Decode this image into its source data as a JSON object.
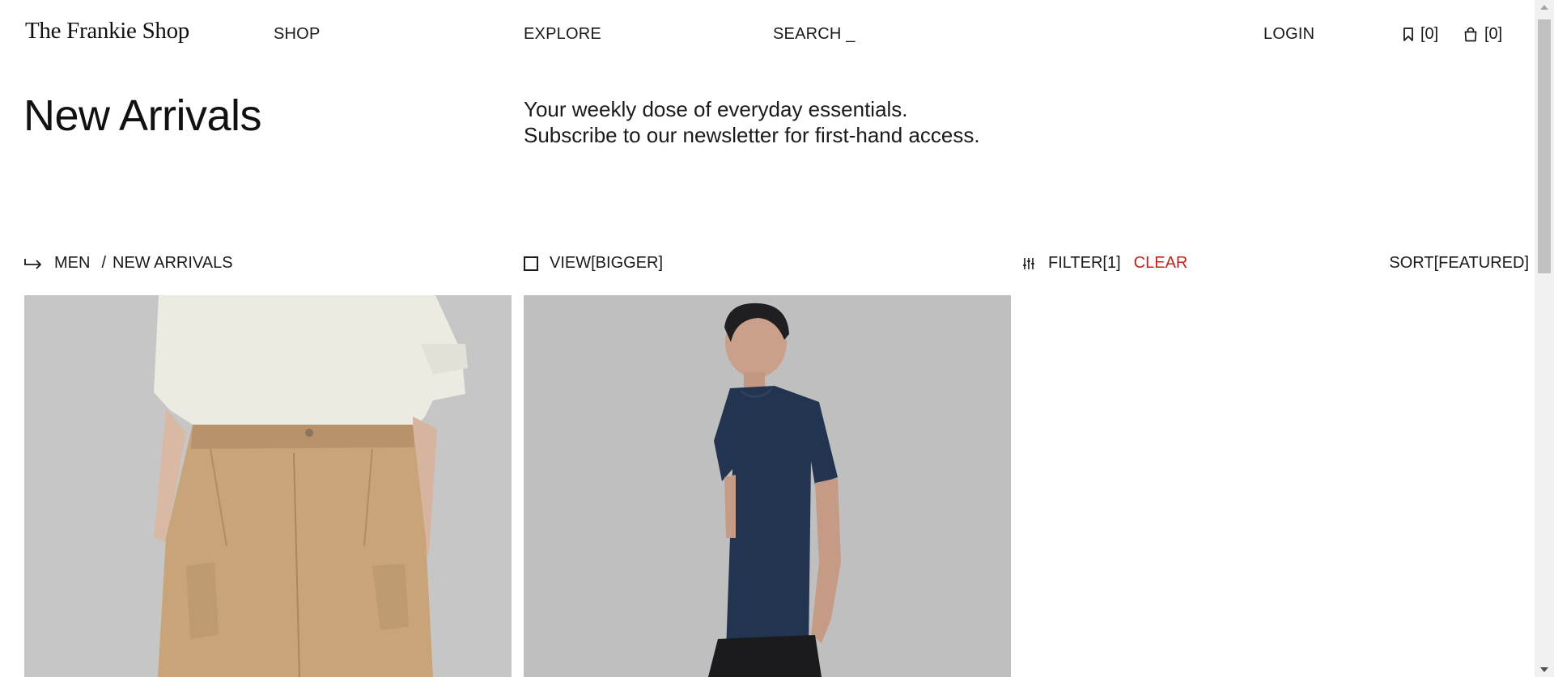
{
  "header": {
    "logo": "The Frankie Shop",
    "nav": {
      "shop": "SHOP",
      "explore": "EXPLORE",
      "search": "SEARCH _",
      "login": "LOGIN"
    },
    "wishlist": {
      "icon": "bookmark-icon",
      "count": "[0]"
    },
    "bag": {
      "icon": "shopping-bag-icon",
      "count": "[0]"
    }
  },
  "intro": {
    "title": "New Arrivals",
    "line1": "Your weekly dose of everyday essentials.",
    "line2": "Subscribe to our newsletter for first-hand access."
  },
  "toolbar": {
    "breadcrumb": {
      "icon": "arrow-right-icon",
      "parent": "MEN",
      "separator": "/",
      "current": "NEW ARRIVALS"
    },
    "view": {
      "icon": "square-icon",
      "label": "VIEW[BIGGER]"
    },
    "filter": {
      "icon": "sliders-icon",
      "label": "FILTER[1]",
      "clear": "CLEAR"
    },
    "sort": "SORT[FEATURED]"
  },
  "products": [
    {
      "image": "model in cream oversized t-shirt and beige cargo pants",
      "colors": {
        "bg": "#c6c6c6",
        "shirt": "#ecebe1",
        "pants": "#c8a478"
      }
    },
    {
      "image": "model in navy t-shirt and black trousers",
      "colors": {
        "bg": "#bfbfbf",
        "shirt": "#22344f",
        "pants": "#1b1b1d"
      }
    }
  ],
  "colors": {
    "accent_clear": "#c8201e",
    "text": "#1a1a1a"
  }
}
